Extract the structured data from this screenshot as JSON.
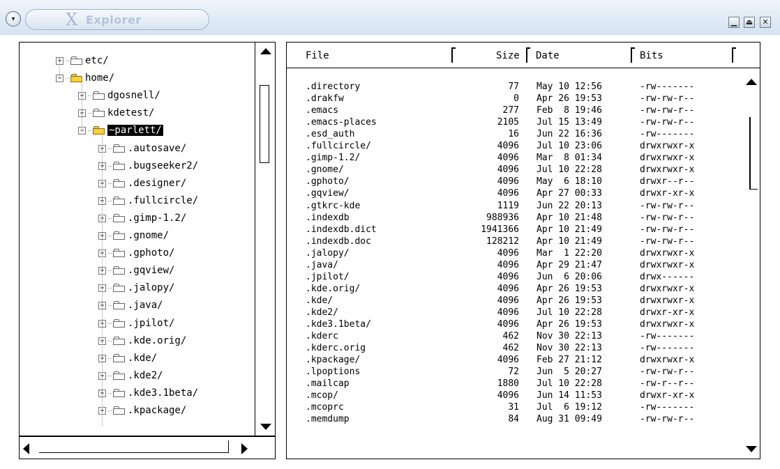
{
  "window": {
    "title": "Explorer",
    "menu_glyph": "▾",
    "controls": {
      "minimize": "▁",
      "maximize": "⏏",
      "close": "✕"
    }
  },
  "tree": {
    "nodes": [
      {
        "label": "etc/",
        "state": "collapsed",
        "open": false
      },
      {
        "label": "home/",
        "state": "expanded",
        "open": true
      },
      {
        "label": "dgosnell/",
        "state": "collapsed",
        "open": false
      },
      {
        "label": "kdetest/",
        "state": "collapsed",
        "open": false
      },
      {
        "label": "~parlett/",
        "state": "expanded",
        "open": true,
        "selected": true
      },
      {
        "label": ".autosave/",
        "state": "collapsed",
        "open": false
      },
      {
        "label": ".bugseeker2/",
        "state": "collapsed",
        "open": false
      },
      {
        "label": ".designer/",
        "state": "collapsed",
        "open": false
      },
      {
        "label": ".fullcircle/",
        "state": "collapsed",
        "open": false
      },
      {
        "label": ".gimp-1.2/",
        "state": "collapsed",
        "open": false
      },
      {
        "label": ".gnome/",
        "state": "collapsed",
        "open": false
      },
      {
        "label": ".gphoto/",
        "state": "collapsed",
        "open": false
      },
      {
        "label": ".gqview/",
        "state": "collapsed",
        "open": false
      },
      {
        "label": ".jalopy/",
        "state": "collapsed",
        "open": false
      },
      {
        "label": ".java/",
        "state": "collapsed",
        "open": false
      },
      {
        "label": ".jpilot/",
        "state": "collapsed",
        "open": false
      },
      {
        "label": ".kde.orig/",
        "state": "collapsed",
        "open": false
      },
      {
        "label": ".kde/",
        "state": "collapsed",
        "open": false
      },
      {
        "label": ".kde2/",
        "state": "collapsed",
        "open": false
      },
      {
        "label": ".kde3.1beta/",
        "state": "collapsed",
        "open": false
      },
      {
        "label": ".kpackage/",
        "state": "collapsed",
        "open": false
      }
    ],
    "expander_collapsed": "+",
    "expander_expanded": "−"
  },
  "list": {
    "headers": {
      "file": "File",
      "size": "Size",
      "date": "Date",
      "bits": "Bits"
    },
    "rows": [
      {
        "name": ".directory",
        "size": "77",
        "date": "May 10 12:56",
        "bits": "-rw-------"
      },
      {
        "name": ".drakfw",
        "size": "0",
        "date": "Apr 26 19:53",
        "bits": "-rw-rw-r--"
      },
      {
        "name": ".emacs",
        "size": "277",
        "date": "Feb  8 19:46",
        "bits": "-rw-rw-r--"
      },
      {
        "name": ".emacs-places",
        "size": "2105",
        "date": "Jul 15 13:49",
        "bits": "-rw-rw-r--"
      },
      {
        "name": ".esd_auth",
        "size": "16",
        "date": "Jun 22 16:36",
        "bits": "-rw-------"
      },
      {
        "name": ".fullcircle/",
        "size": "4096",
        "date": "Jul 10 23:06",
        "bits": "drwxrwxr-x"
      },
      {
        "name": ".gimp-1.2/",
        "size": "4096",
        "date": "Mar  8 01:34",
        "bits": "drwxrwxr-x"
      },
      {
        "name": ".gnome/",
        "size": "4096",
        "date": "Jul 10 22:28",
        "bits": "drwxrwxr-x"
      },
      {
        "name": ".gphoto/",
        "size": "4096",
        "date": "May  6 18:10",
        "bits": "drwxr--r--"
      },
      {
        "name": ".gqview/",
        "size": "4096",
        "date": "Apr 27 00:33",
        "bits": "drwxr-xr-x"
      },
      {
        "name": ".gtkrc-kde",
        "size": "1119",
        "date": "Jun 22 20:13",
        "bits": "-rw-rw-r--"
      },
      {
        "name": ".indexdb",
        "size": "988936",
        "date": "Apr 10 21:48",
        "bits": "-rw-rw-r--"
      },
      {
        "name": ".indexdb.dict",
        "size": "1941366",
        "date": "Apr 10 21:49",
        "bits": "-rw-rw-r--"
      },
      {
        "name": ".indexdb.doc",
        "size": "128212",
        "date": "Apr 10 21:49",
        "bits": "-rw-rw-r--"
      },
      {
        "name": ".jalopy/",
        "size": "4096",
        "date": "Mar  1 22:20",
        "bits": "drwxrwxr-x"
      },
      {
        "name": ".java/",
        "size": "4096",
        "date": "Apr 29 21:47",
        "bits": "drwxrwxr-x"
      },
      {
        "name": ".jpilot/",
        "size": "4096",
        "date": "Jun  6 20:06",
        "bits": "drwx------"
      },
      {
        "name": ".kde.orig/",
        "size": "4096",
        "date": "Apr 26 19:53",
        "bits": "drwxrwxr-x"
      },
      {
        "name": ".kde/",
        "size": "4096",
        "date": "Apr 26 19:53",
        "bits": "drwxrwxr-x"
      },
      {
        "name": ".kde2/",
        "size": "4096",
        "date": "Jul 10 22:28",
        "bits": "drwxr-xr-x"
      },
      {
        "name": ".kde3.1beta/",
        "size": "4096",
        "date": "Apr 26 19:53",
        "bits": "drwxrwxr-x"
      },
      {
        "name": ".kderc",
        "size": "462",
        "date": "Nov 30 22:13",
        "bits": "-rw-------"
      },
      {
        "name": ".kderc.orig",
        "size": "462",
        "date": "Nov 30 22:13",
        "bits": "-rw-------"
      },
      {
        "name": ".kpackage/",
        "size": "4096",
        "date": "Feb 27 21:12",
        "bits": "drwxrwxr-x"
      },
      {
        "name": ".lpoptions",
        "size": "72",
        "date": "Jun  5 20:27",
        "bits": "-rw-rw-r--"
      },
      {
        "name": ".mailcap",
        "size": "1880",
        "date": "Jul 10 22:28",
        "bits": "-rw-r--r--"
      },
      {
        "name": ".mcop/",
        "size": "4096",
        "date": "Jun 14 11:53",
        "bits": "drwxr-xr-x"
      },
      {
        "name": ".mcoprc",
        "size": "31",
        "date": "Jul  6 19:12",
        "bits": "-rw-------"
      },
      {
        "name": ".memdump",
        "size": "84",
        "date": "Aug 31 09:49",
        "bits": "-rw-rw-r--"
      }
    ]
  },
  "colors": {
    "titlebar": "#d6e3f1",
    "selection_bg": "#000000",
    "open_folder": "#f5d13b"
  }
}
